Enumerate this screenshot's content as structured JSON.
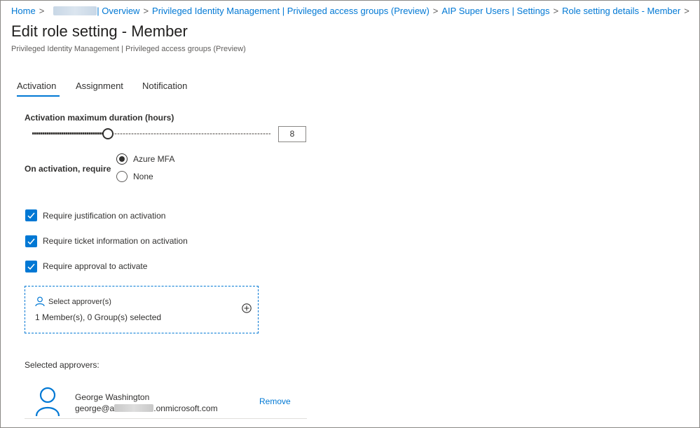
{
  "breadcrumb": {
    "home": "Home",
    "tenant_suffix": "| Overview",
    "pim": "Privileged Identity Management | Privileged access groups (Preview)",
    "group": "AIP Super Users | Settings",
    "current": "Role setting details - Member",
    "separator": ">"
  },
  "page": {
    "title": "Edit role setting - Member",
    "subtitle": "Privileged Identity Management | Privileged access groups (Preview)"
  },
  "tabs": [
    {
      "label": "Activation",
      "active": true
    },
    {
      "label": "Assignment",
      "active": false
    },
    {
      "label": "Notification",
      "active": false
    }
  ],
  "activation": {
    "duration_label": "Activation maximum duration (hours)",
    "duration_value": "8",
    "duration_max": 24,
    "require_label": "On activation, require",
    "require_options": [
      {
        "label": "Azure MFA",
        "selected": true
      },
      {
        "label": "None",
        "selected": false
      }
    ],
    "checkboxes": [
      {
        "label": "Require justification on activation",
        "checked": true
      },
      {
        "label": "Require ticket information on activation",
        "checked": true
      },
      {
        "label": "Require approval to activate",
        "checked": true
      }
    ],
    "approver_picker": {
      "label": "Select approver(s)",
      "summary": "1 Member(s), 0 Group(s) selected"
    },
    "selected_approvers_label": "Selected approvers:",
    "approvers": [
      {
        "name": "George Washington",
        "email_prefix": "george@a",
        "email_suffix": ".onmicrosoft.com",
        "remove_label": "Remove"
      }
    ]
  },
  "colors": {
    "accent": "#0078d4",
    "text": "#323130"
  },
  "icons": {
    "approver_picker": "person-icon",
    "add": "plus-circle-icon",
    "approver_avatar": "person-avatar-icon"
  }
}
